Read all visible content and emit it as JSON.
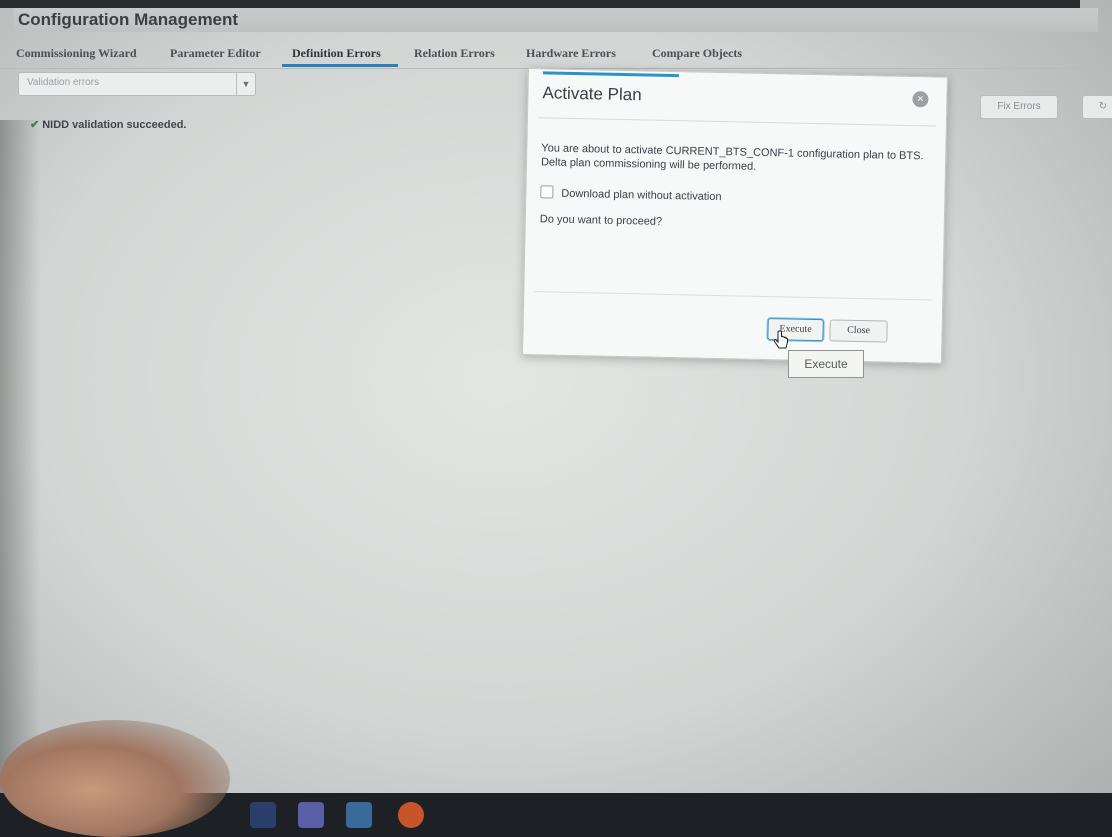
{
  "app": {
    "title": "Configuration Management"
  },
  "tabs": [
    {
      "label": "Commissioning Wizard"
    },
    {
      "label": "Parameter Editor"
    },
    {
      "label": "Definition Errors",
      "active": true
    },
    {
      "label": "Relation Errors"
    },
    {
      "label": "Hardware Errors"
    },
    {
      "label": "Compare Objects"
    }
  ],
  "filter": {
    "placeholder": "Validation errors"
  },
  "status": {
    "message": "NIDD validation succeeded."
  },
  "side_buttons": {
    "fix_errors": "Fix Errors"
  },
  "dialog": {
    "title": "Activate Plan",
    "message": "You are about to activate CURRENT_BTS_CONF-1 configuration plan to BTS. Delta plan commissioning will be performed.",
    "checkbox_label": "Download plan without activation",
    "question": "Do you want to proceed?",
    "execute_label": "Execute",
    "close_label": "Close"
  },
  "tooltip": {
    "text": "Execute"
  },
  "colors": {
    "accent": "#2c93c8",
    "tab_underline": "#2c7fb8",
    "taskbar": "#1d2024"
  }
}
